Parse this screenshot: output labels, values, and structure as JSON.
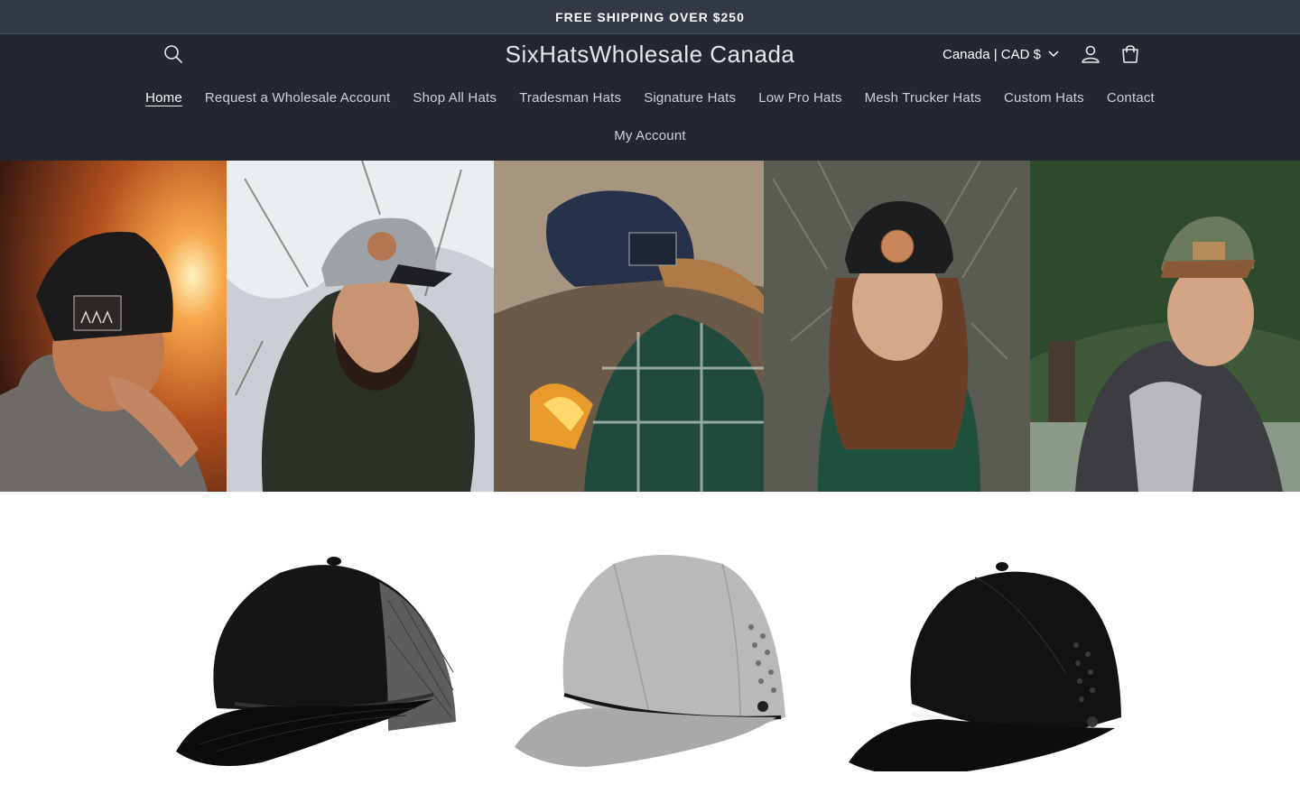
{
  "announcement": {
    "text": "FREE SHIPPING OVER $250"
  },
  "header": {
    "site_title": "SixHatsWholesale Canada",
    "currency_label": "Canada | CAD $",
    "icons": {
      "search": "search-icon",
      "account": "user-icon",
      "cart": "cart-icon",
      "dropdown": "chevron-down-icon"
    }
  },
  "nav": {
    "items": [
      {
        "label": "Home",
        "active": true
      },
      {
        "label": "Request a Wholesale Account"
      },
      {
        "label": "Shop All Hats"
      },
      {
        "label": "Tradesman Hats"
      },
      {
        "label": "Signature Hats"
      },
      {
        "label": "Low Pro Hats"
      },
      {
        "label": "Mesh Trucker Hats"
      },
      {
        "label": "Custom Hats"
      },
      {
        "label": "Contact"
      }
    ],
    "secondary": [
      {
        "label": "My Account"
      }
    ]
  },
  "banner": {
    "panels": [
      {
        "subject": "man-black-cap-sunset"
      },
      {
        "subject": "bearded-man-grey-cap-snow"
      },
      {
        "subject": "man-denim-cap-campfire"
      },
      {
        "subject": "woman-black-cap-forest"
      },
      {
        "subject": "man-green-cap-hoodie"
      }
    ]
  },
  "products": [
    {
      "subject": "black-grey-mesh-trucker-hat"
    },
    {
      "subject": "grey-rope-perforated-hat"
    },
    {
      "subject": "black-white-rope-perforated-hat"
    }
  ],
  "colors": {
    "announcement_bg": "#323844",
    "header_bg": "#232830",
    "page_bg": "#ffffff"
  }
}
